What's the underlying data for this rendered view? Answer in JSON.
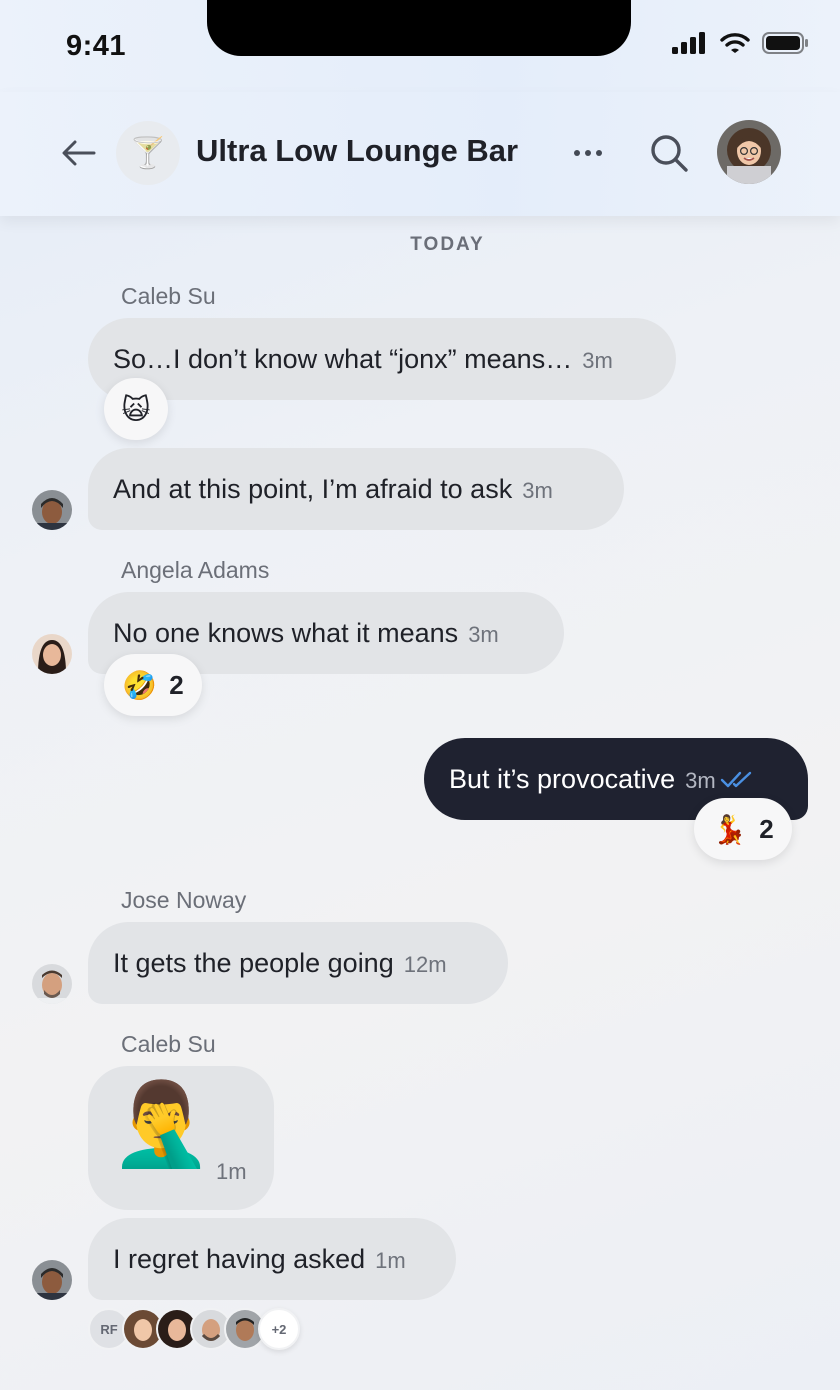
{
  "status_bar": {
    "time": "9:41"
  },
  "header": {
    "title": "Ultra Low Lounge Bar",
    "group_icon": "🍸"
  },
  "day_label": "TODAY",
  "messages": [
    {
      "sender": "Caleb Su",
      "text": "So…I don’t know what “jonx” means…",
      "time": "3m",
      "reaction": {
        "emoji": "🙀"
      }
    },
    {
      "text": "And at this point, I’m afraid to ask",
      "time": "3m"
    },
    {
      "sender": "Angela Adams",
      "text": "No one knows what it means",
      "time": "3m",
      "reaction": {
        "emoji": "🤣",
        "count": "2"
      }
    },
    {
      "text": "But it’s provocative",
      "time": "3m",
      "reaction": {
        "emoji": "💃",
        "count": "2"
      }
    },
    {
      "sender": "Jose Noway",
      "text": "It gets the people going",
      "time": "12m"
    },
    {
      "sender": "Caleb Su",
      "sticker": "🤦‍♂️",
      "time": "1m"
    },
    {
      "text": "I regret having asked",
      "time": "1m"
    }
  ],
  "read_receipts": {
    "initials": "RF",
    "more": "+2"
  },
  "colors": {
    "accent": "#4a90e2",
    "own_bubble": "#1f2230",
    "other_bubble": "#e2e4e7"
  }
}
